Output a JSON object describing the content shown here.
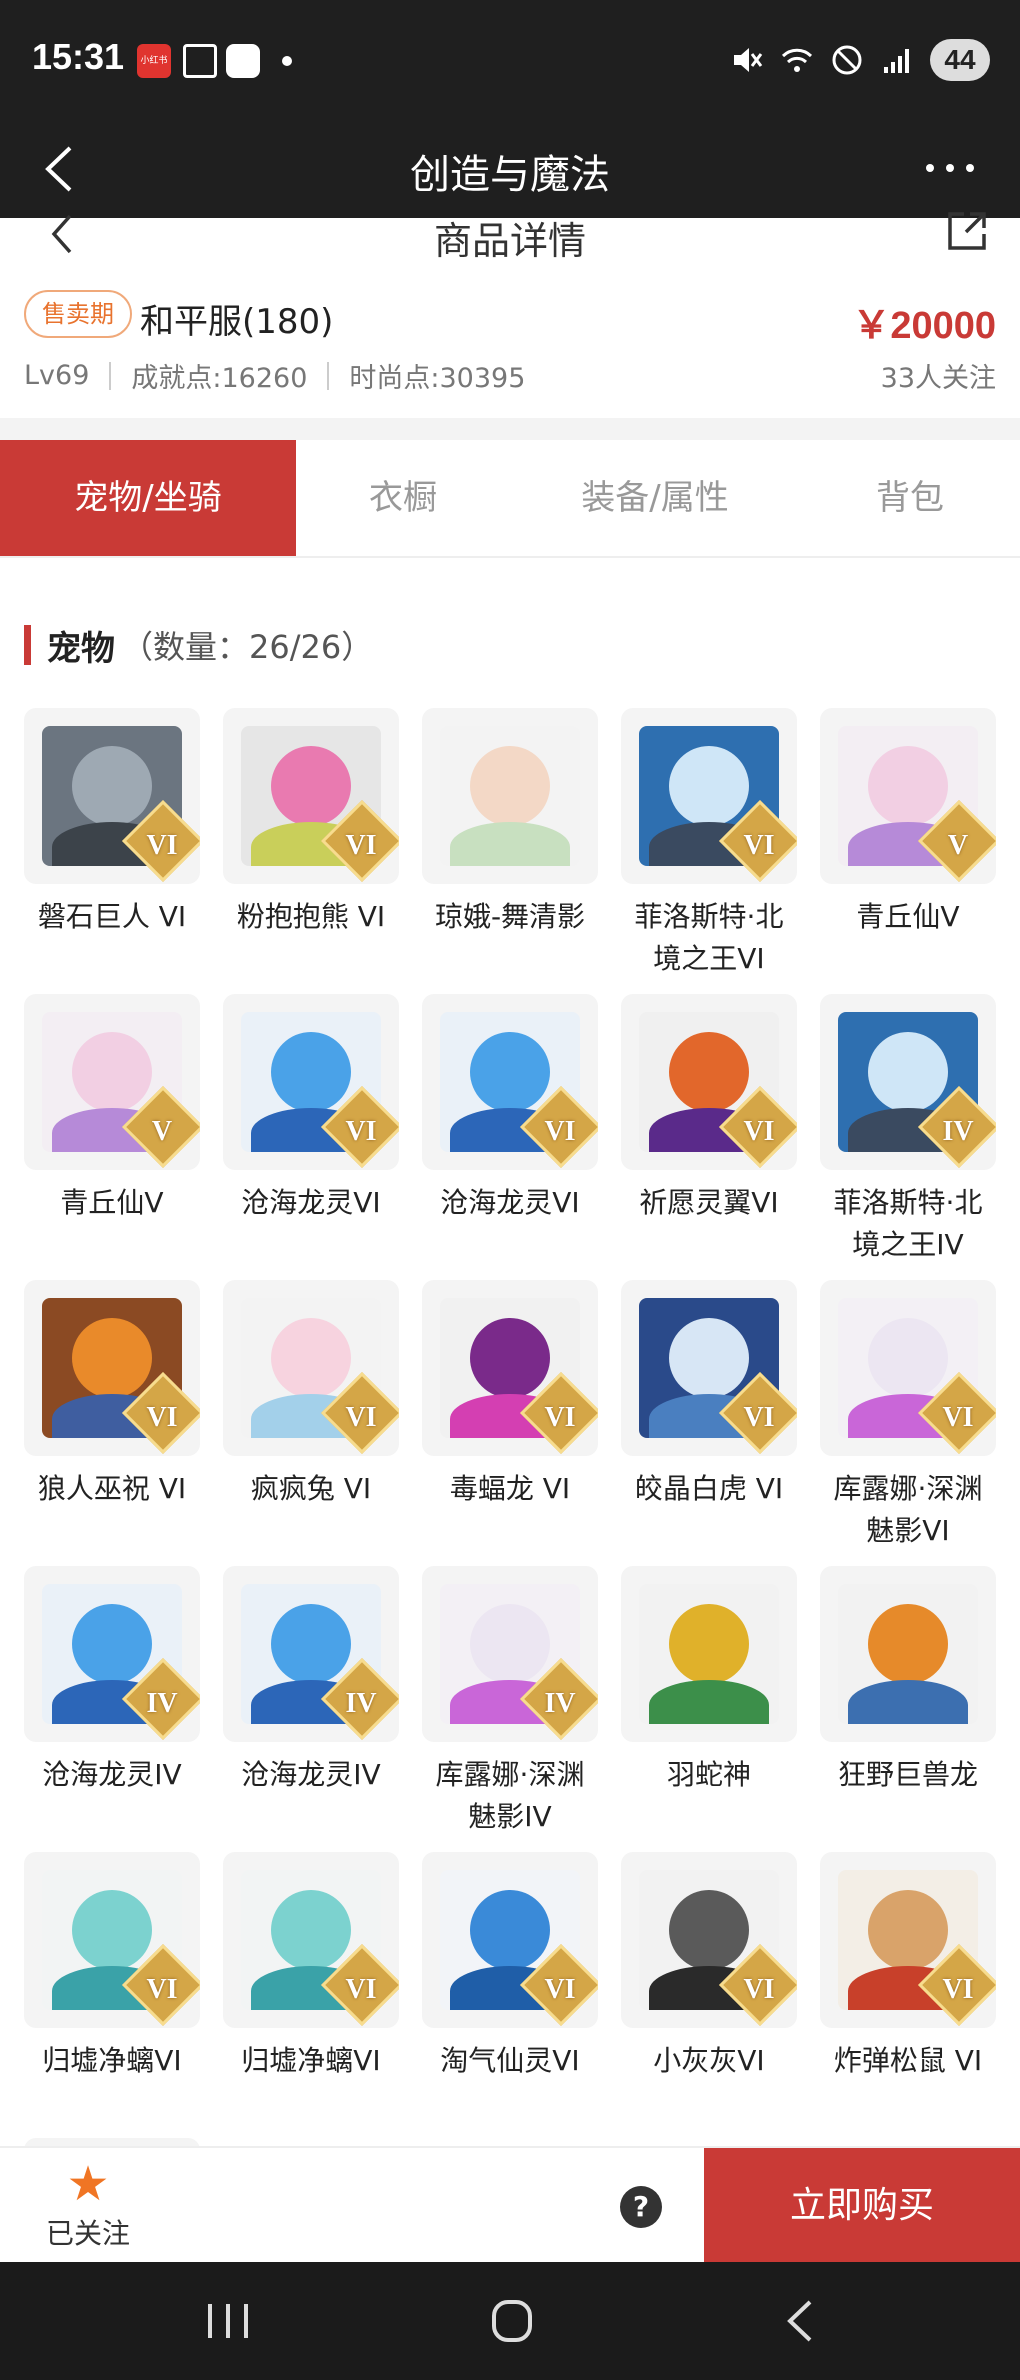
{
  "status_bar": {
    "time": "15:31",
    "app_badge": "小红书",
    "battery": "44"
  },
  "app_header": {
    "title": "创造与魔法"
  },
  "page_header": {
    "title": "商品详情"
  },
  "product": {
    "badge": "售卖期",
    "name": "和平服(180)",
    "price": "￥20000",
    "level": "Lv69",
    "achievement": "成就点:16260",
    "fashion": "时尚点:30395",
    "followers": "33人关注"
  },
  "tabs": [
    {
      "label": "宠物/坐骑",
      "active": true
    },
    {
      "label": "衣橱",
      "active": false
    },
    {
      "label": "装备/属性",
      "active": false
    },
    {
      "label": "背包",
      "active": false
    }
  ],
  "section": {
    "title": "宠物",
    "count": "（数量：26/26）"
  },
  "pets": [
    {
      "name": "磐石巨人 VI",
      "rank": "VI",
      "colors": [
        "#6b7580",
        "#9ea9b3",
        "#3c434a"
      ]
    },
    {
      "name": "粉抱抱熊 VI",
      "rank": "VI",
      "colors": [
        "#e6e6e6",
        "#e97ab0",
        "#c9cf5a"
      ]
    },
    {
      "name": "琼娥-舞清影",
      "rank": "",
      "colors": [
        "#f3f3f3",
        "#f3d8c6",
        "#c8e0c0"
      ]
    },
    {
      "name": "菲洛斯特·北境之王VI",
      "rank": "VI",
      "colors": [
        "#2e6fb0",
        "#cfe6f7",
        "#3a4a60"
      ]
    },
    {
      "name": "青丘仙V",
      "rank": "V",
      "colors": [
        "#f3eef3",
        "#f2cfe3",
        "#b68ad8"
      ]
    },
    {
      "name": "青丘仙V",
      "rank": "V",
      "colors": [
        "#f3eef3",
        "#f2cfe3",
        "#b68ad8"
      ]
    },
    {
      "name": "沧海龙灵VI",
      "rank": "VI",
      "colors": [
        "#eaf1f8",
        "#4aa2e8",
        "#2c66b8"
      ]
    },
    {
      "name": "沧海龙灵VI",
      "rank": "VI",
      "colors": [
        "#eaf1f8",
        "#4aa2e8",
        "#2c66b8"
      ]
    },
    {
      "name": "祈愿灵翼VI",
      "rank": "VI",
      "colors": [
        "#f0f0f0",
        "#e2672b",
        "#5a2a8a"
      ]
    },
    {
      "name": "菲洛斯特·北境之王IV",
      "rank": "IV",
      "colors": [
        "#2e6fb0",
        "#cfe6f7",
        "#3a4a60"
      ]
    },
    {
      "name": "狼人巫祝 VI",
      "rank": "VI",
      "colors": [
        "#8b4a23",
        "#e98a2a",
        "#3f5ea0"
      ]
    },
    {
      "name": "疯疯兔 VI",
      "rank": "VI",
      "colors": [
        "#f3f3f3",
        "#f7d3df",
        "#a3d0ea"
      ]
    },
    {
      "name": "毒蝠龙 VI",
      "rank": "VI",
      "colors": [
        "#f1f1f1",
        "#7a2a8a",
        "#d43fb2"
      ]
    },
    {
      "name": "皎晶白虎 VI",
      "rank": "VI",
      "colors": [
        "#2a4a8a",
        "#d7e6f5",
        "#4a7fc0"
      ]
    },
    {
      "name": "库露娜·深渊魅影VI",
      "rank": "VI",
      "colors": [
        "#f3f0f5",
        "#ece6f2",
        "#c966d8"
      ]
    },
    {
      "name": "沧海龙灵IV",
      "rank": "IV",
      "colors": [
        "#eaf1f8",
        "#4aa2e8",
        "#2c66b8"
      ]
    },
    {
      "name": "沧海龙灵IV",
      "rank": "IV",
      "colors": [
        "#eaf1f8",
        "#4aa2e8",
        "#2c66b8"
      ]
    },
    {
      "name": "库露娜·深渊魅影IV",
      "rank": "IV",
      "colors": [
        "#f3f0f5",
        "#ece6f2",
        "#c966d8"
      ]
    },
    {
      "name": "羽蛇神",
      "rank": "",
      "colors": [
        "#f2f2f2",
        "#e0b12a",
        "#3c8f4a"
      ]
    },
    {
      "name": "狂野巨兽龙",
      "rank": "",
      "colors": [
        "#f2f2f2",
        "#e68a2a",
        "#3c6fb0"
      ]
    },
    {
      "name": "归墟净螭VI",
      "rank": "VI",
      "colors": [
        "#f2f4f4",
        "#7cd2cf",
        "#3aa2a8"
      ]
    },
    {
      "name": "归墟净螭VI",
      "rank": "VI",
      "colors": [
        "#f2f4f4",
        "#7cd2cf",
        "#3aa2a8"
      ]
    },
    {
      "name": "淘气仙灵VI",
      "rank": "VI",
      "colors": [
        "#f2f4f8",
        "#3a8ad8",
        "#1f5ea8"
      ]
    },
    {
      "name": "小灰灰VI",
      "rank": "VI",
      "colors": [
        "#f2f2f2",
        "#5a5a5a",
        "#2a2a2a"
      ]
    },
    {
      "name": "炸弹松鼠 VI",
      "rank": "VI",
      "colors": [
        "#f3eee6",
        "#d9a36a",
        "#c8402a"
      ]
    },
    {
      "name": "",
      "rank": "",
      "colors": [
        "#f4f4f4",
        "#e87ab0",
        "#6fb84a"
      ]
    }
  ],
  "action_bar": {
    "follow_label": "已关注",
    "help": "?",
    "buy_label": "立即购买"
  }
}
